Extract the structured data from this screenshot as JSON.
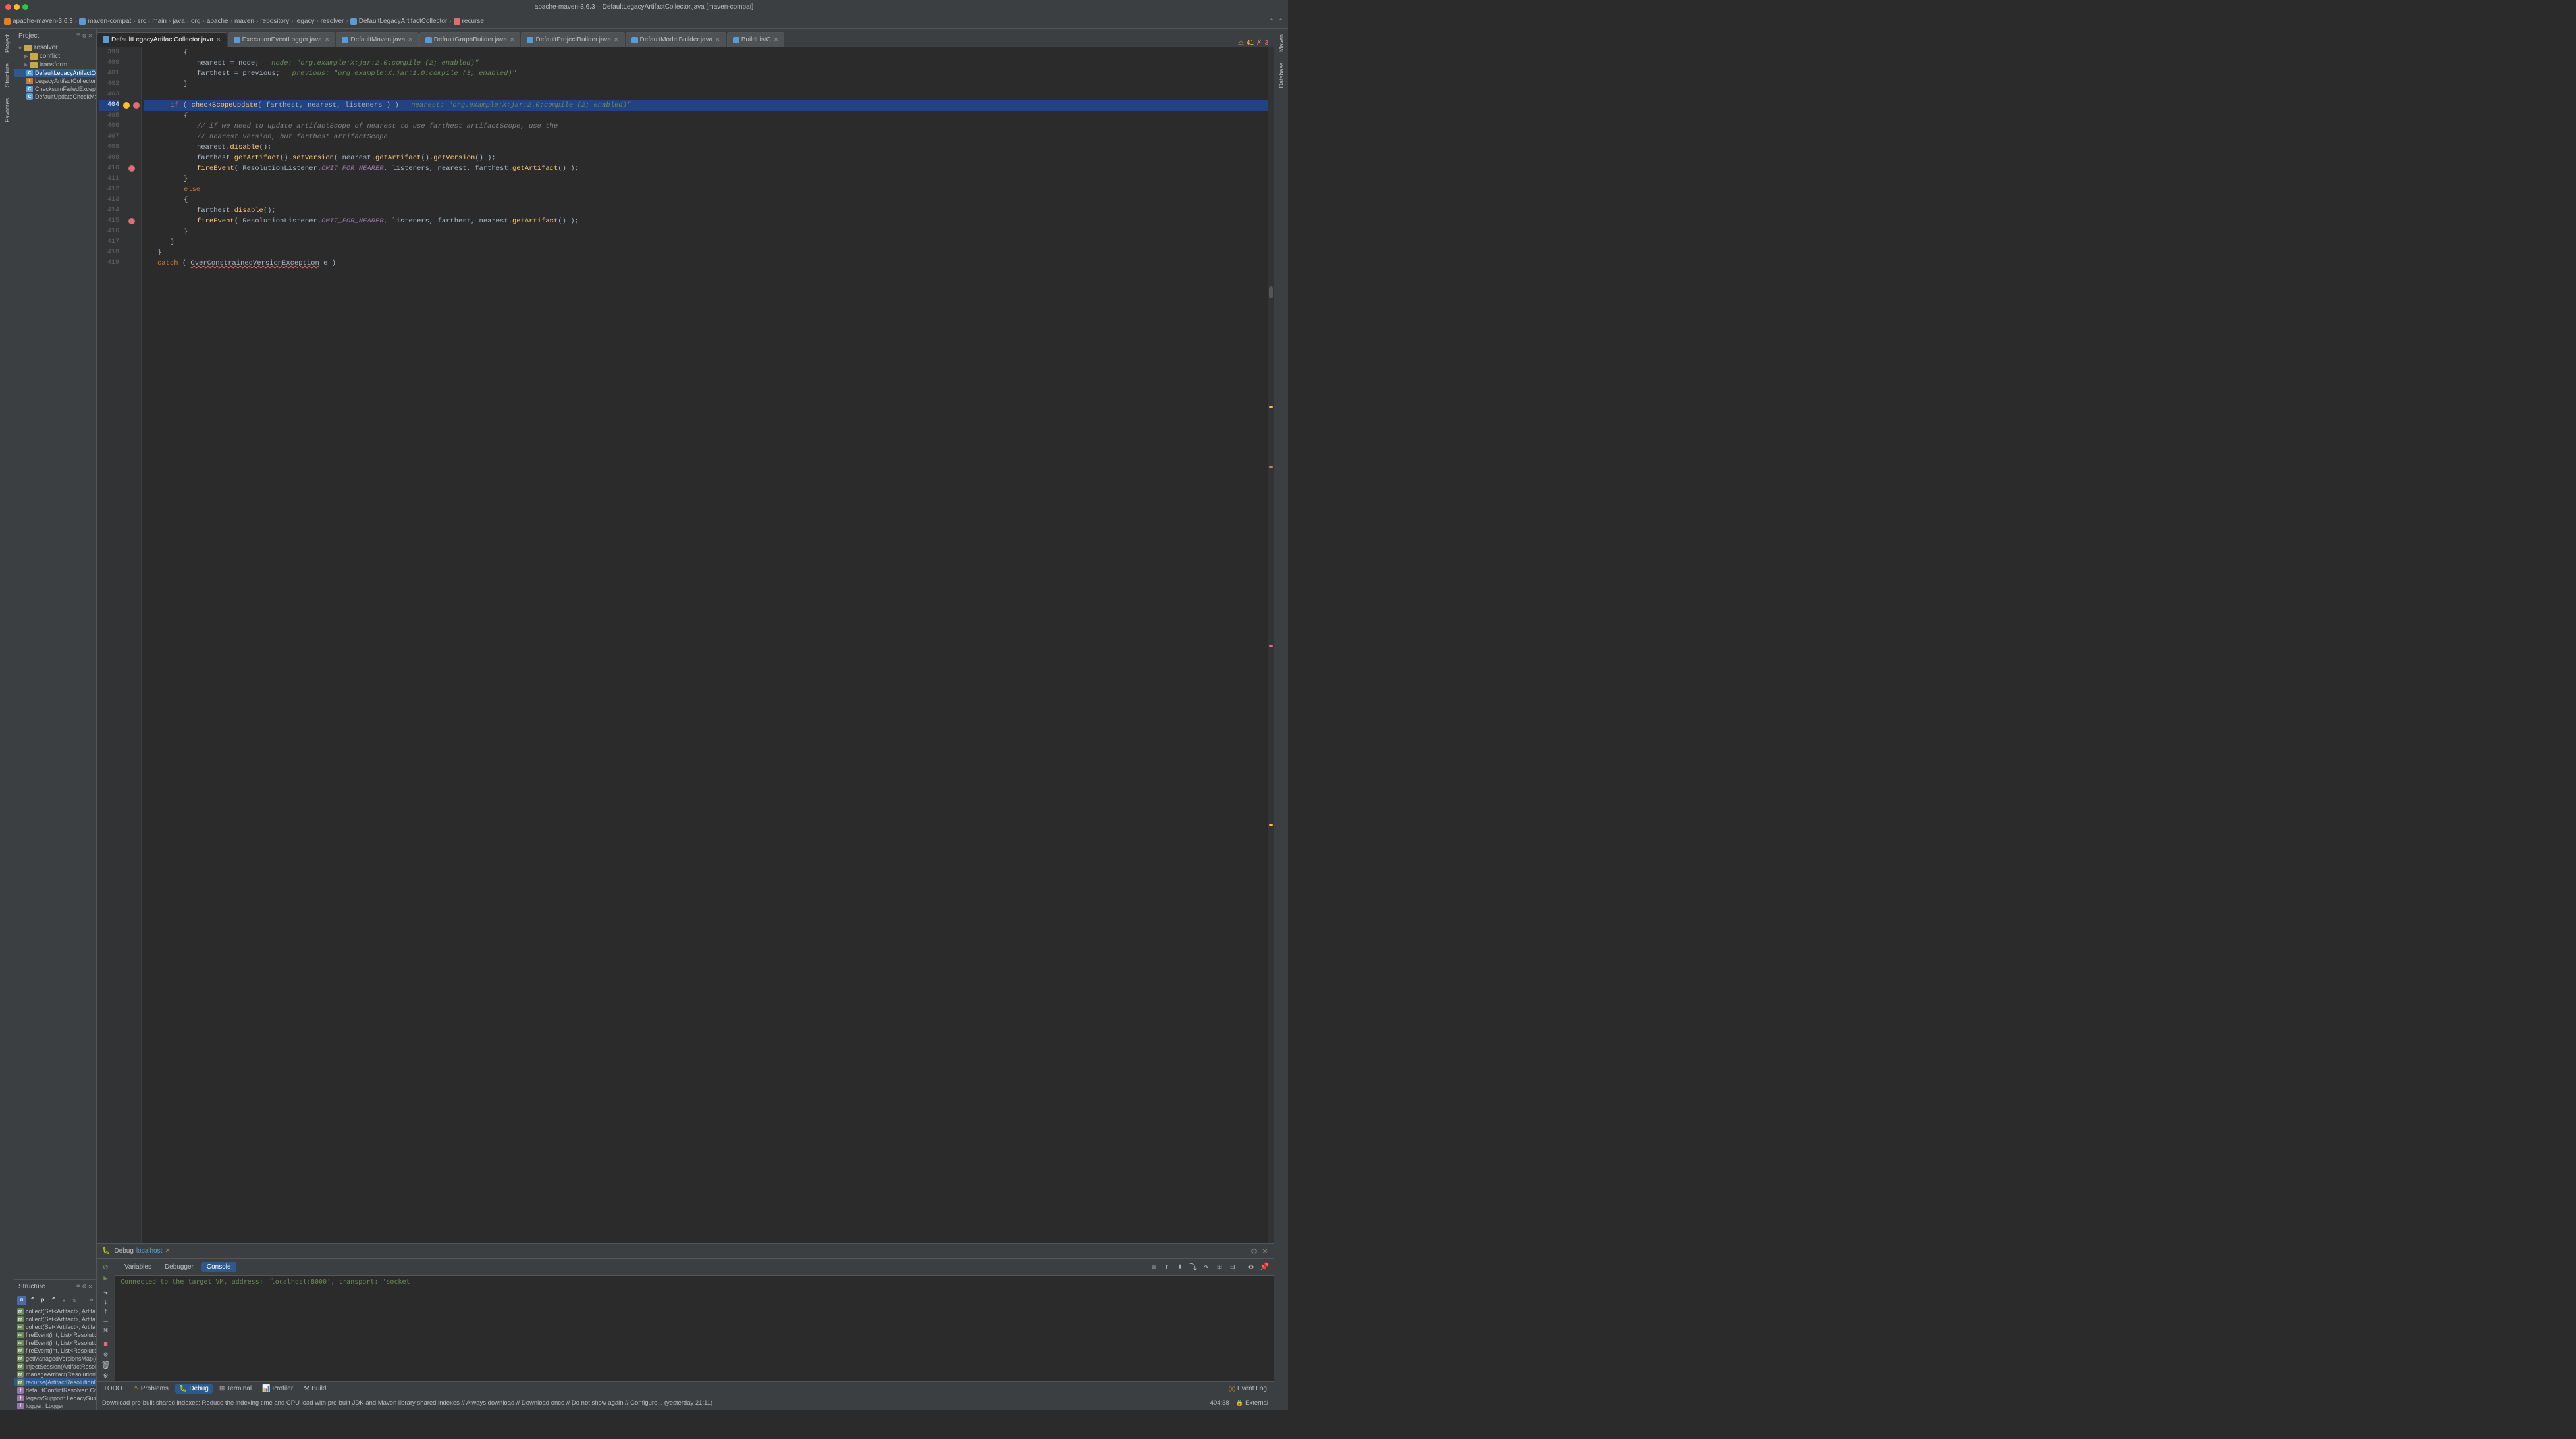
{
  "window": {
    "title": "apache-maven-3.6.3 – DefaultLegacyArtifactCollector.java [maven-compat]",
    "traffic_lights": [
      "red",
      "yellow",
      "green"
    ]
  },
  "breadcrumb": {
    "items": [
      "apache-maven-3.6.3",
      "maven-compat",
      "src",
      "main",
      "java",
      "org",
      "apache",
      "maven",
      "repository",
      "legacy",
      "resolver",
      "DefaultLegacyArtifactCollector",
      "recurse"
    ],
    "icons": [
      "orange",
      "blue",
      "blue",
      "blue",
      "blue",
      "blue",
      "blue",
      "blue",
      "blue",
      "blue",
      "blue",
      "blue",
      "red"
    ]
  },
  "sidebar": {
    "title": "Project",
    "tree_items": [
      {
        "label": "resolver",
        "type": "folder",
        "indent": 0
      },
      {
        "label": "conflict",
        "type": "folder",
        "indent": 1
      },
      {
        "label": "transform",
        "type": "folder",
        "indent": 1
      },
      {
        "label": "DefaultLegacyArtifactCollector",
        "type": "class",
        "indent": 1,
        "selected": true
      },
      {
        "label": "LegacyArtifactCollector",
        "type": "interface",
        "indent": 1
      },
      {
        "label": "ChecksumFailedException",
        "type": "class",
        "indent": 1
      },
      {
        "label": "DefaultUpdateCheckManager",
        "type": "class",
        "indent": 1
      }
    ]
  },
  "structure": {
    "title": "Structure",
    "methods": [
      {
        "label": "collect(Set<Artifact>, Artifa",
        "type": "public",
        "icon": "m"
      },
      {
        "label": "collect(Set<Artifact>, Artifa",
        "type": "public",
        "icon": "m"
      },
      {
        "label": "collect(Set<Artifact>, Artifa",
        "type": "public",
        "icon": "m"
      },
      {
        "label": "fireEvent(int, List<Resolutio",
        "type": "public",
        "icon": "m"
      },
      {
        "label": "fireEvent(int, List<Resolutio",
        "type": "public",
        "icon": "m"
      },
      {
        "label": "fireEvent(int, List<Resolutio",
        "type": "public",
        "icon": "m"
      },
      {
        "label": "getManagedVersionsMap(Ar",
        "type": "public",
        "icon": "m"
      },
      {
        "label": "injectSession(ArtifactResolutionN",
        "type": "public",
        "icon": "m"
      },
      {
        "label": "manageArtifact(ResolutionN",
        "type": "public",
        "icon": "m"
      },
      {
        "label": "recurse(ArtifactResolutionRe",
        "type": "public",
        "icon": "m",
        "selected": true
      },
      {
        "label": "defaultConflictResolver: Con",
        "type": "field",
        "icon": "f"
      },
      {
        "label": "legacySupport: LegacySupp",
        "type": "field",
        "icon": "f"
      },
      {
        "label": "logger: Logger",
        "type": "field",
        "icon": "f"
      }
    ]
  },
  "tabs": [
    {
      "label": "DefaultLegacyArtifactCollector.java",
      "active": true,
      "icon": "blue"
    },
    {
      "label": "ExecutionEventLogger.java",
      "active": false,
      "icon": "blue"
    },
    {
      "label": "DefaultMaven.java",
      "active": false,
      "icon": "blue"
    },
    {
      "label": "DefaultGraphBuilder.java",
      "active": false,
      "icon": "blue"
    },
    {
      "label": "DefaultProjectBuilder.java",
      "active": false,
      "icon": "blue"
    },
    {
      "label": "DefaultModelBuilder.java",
      "active": false,
      "icon": "blue"
    },
    {
      "label": "BuildListC",
      "active": false,
      "icon": "blue"
    }
  ],
  "code": {
    "lines": [
      {
        "num": 399,
        "content": "        {",
        "highlighted": false
      },
      {
        "num": 400,
        "content": "            nearest = node;   node: \"org.example:X:jar:2.0:compile (2; enabled)\"",
        "highlighted": false
      },
      {
        "num": 401,
        "content": "            farthest = previous;   previous: \"org.example:X:jar:1.0:compile (3; enabled)\"",
        "highlighted": false
      },
      {
        "num": 402,
        "content": "        }",
        "highlighted": false
      },
      {
        "num": 403,
        "content": "",
        "highlighted": false
      },
      {
        "num": 404,
        "content": "if ( checkScopeUpdate( farthest, nearest, listeners ) )   nearest: \"org.example:X:jar:2.0:compile (2; enabled)\"",
        "highlighted": true,
        "breakpoint": "yellow",
        "error": true
      },
      {
        "num": 405,
        "content": "            {",
        "highlighted": false
      },
      {
        "num": 406,
        "content": "                // if we need to update artifactScope of nearest to use farthest artifactScope, use the",
        "highlighted": false,
        "is_comment": true
      },
      {
        "num": 407,
        "content": "                // nearest version, but farthest artifactScope",
        "highlighted": false,
        "is_comment": true
      },
      {
        "num": 408,
        "content": "                nearest.disable();",
        "highlighted": false
      },
      {
        "num": 409,
        "content": "                farthest.getArtifact().setVersion( nearest.getArtifact().getVersion() );",
        "highlighted": false
      },
      {
        "num": 410,
        "content": "                fireEvent( ResolutionListener.OMIT_FOR_NEARER, listeners, nearest, farthest.getArtifact() );",
        "highlighted": false,
        "error": true
      },
      {
        "num": 411,
        "content": "            }",
        "highlighted": false
      },
      {
        "num": 412,
        "content": "            else",
        "highlighted": false
      },
      {
        "num": 413,
        "content": "            {",
        "highlighted": false
      },
      {
        "num": 414,
        "content": "                farthest.disable();",
        "highlighted": false
      },
      {
        "num": 415,
        "content": "                fireEvent( ResolutionListener.OMIT_FOR_NEARER, listeners, farthest, nearest.getArtifact() );",
        "highlighted": false,
        "error": true
      },
      {
        "num": 416,
        "content": "            }",
        "highlighted": false
      },
      {
        "num": 417,
        "content": "        }",
        "highlighted": false
      },
      {
        "num": 418,
        "content": "    }",
        "highlighted": false
      },
      {
        "num": 419,
        "content": "    catch ( OverConstrainedVersionException e )",
        "highlighted": false
      }
    ]
  },
  "debug": {
    "title": "Debug",
    "session": "localhost",
    "tabs": [
      "Variables",
      "Debugger",
      "Console"
    ],
    "active_tab": "Console",
    "console_message": "Connected to the target VM, address: 'localhost:8000', transport: 'socket'"
  },
  "bottom_tabs": [
    {
      "label": "TODO",
      "icon": "list"
    },
    {
      "label": "Problems",
      "icon": "warning"
    },
    {
      "label": "Debug",
      "icon": "bug",
      "active": true
    },
    {
      "label": "Terminal",
      "icon": "terminal"
    },
    {
      "label": "Profiler",
      "icon": "profiler"
    },
    {
      "label": "Build",
      "icon": "build"
    }
  ],
  "status_bar": {
    "left": "Download pre-built shared indexes: Reduce the indexing time and CPU load with pre-built JDK and Maven library shared indexes // Always download // Download once // Do not show again // Configure... (yesterday 21:11)",
    "right": "404:38",
    "encoding": "External"
  },
  "right_panel": {
    "warnings_count": "41",
    "errors_count": "3"
  }
}
